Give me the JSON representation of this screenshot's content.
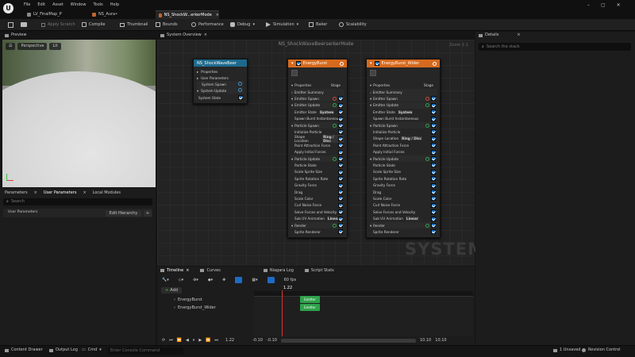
{
  "menu": {
    "items": [
      "File",
      "Edit",
      "Asset",
      "Window",
      "Tools",
      "Help"
    ]
  },
  "tabs": [
    {
      "label": "LV_FinalMap_P"
    },
    {
      "label": "NS_Aura•"
    },
    {
      "label": "NS_ShockW...erkerMode"
    }
  ],
  "toolbar": {
    "apply_scratch": "Apply Scratch",
    "compile": "Compile",
    "thumbnail": "Thumbnail",
    "bounds": "Bounds",
    "performance": "Performance",
    "debug": "Debug",
    "simulation": "Simulation",
    "baker": "Baker",
    "scalability": "Scalability"
  },
  "preview": {
    "tab": "Preview",
    "perspective": "Perspective",
    "lit": "Lit"
  },
  "params": {
    "tab_parameters": "Parameters",
    "tab_user": "User Parameters",
    "tab_local": "Local Modules",
    "search_placeholder": "Search",
    "group": "User Parameters",
    "edit_hierarchy": "Edit Hierarchy"
  },
  "overview": {
    "tab": "System Overview",
    "title": "NS_ShockWaveBeerserkerMode",
    "zoom": "Zoom 1:1",
    "watermark": "SYSTEM"
  },
  "system_node": {
    "title": "NS_ShockWaveBeer",
    "rows": [
      "Properties",
      "User Parameters",
      "System Spawn",
      "System Update",
      "System State"
    ]
  },
  "emitters": [
    {
      "title": "EnergyBurst",
      "rows": [
        "Properties",
        "Emitter Summary",
        "Emitter Spawn",
        "Emitter Update",
        "Emitter State",
        "Spawn Burst Instantaneous",
        "Particle Spawn",
        "Initialize Particle",
        "Shape Location",
        "Point Attraction Force",
        "Apply Initial Forces",
        "Particle Update",
        "Particle State",
        "Scale Sprite Size",
        "Sprite Rotation Rate",
        "Gravity Force",
        "Drag",
        "Scale Color",
        "Curl Noise Force",
        "Solve Forces and Velocity",
        "Sub UV Animation",
        "Render",
        "Sprite Renderer"
      ],
      "stage": "Stage",
      "emitter_state_value": "System",
      "shape_value": "Ring / Disc",
      "subuv_value": "Linear"
    },
    {
      "title": "EnergyBurst_Wider",
      "rows": [
        "Properties",
        "Emitter Summary",
        "Emitter Spawn",
        "Emitter Update",
        "Emitter State",
        "Spawn Burst Instantaneous",
        "Particle Spawn",
        "Initialize Particle",
        "Shape Location",
        "Point Attraction Force",
        "Apply Initial Forces",
        "Particle Update",
        "Particle State",
        "Scale Sprite Size",
        "Sprite Rotation Rate",
        "Gravity Force",
        "Drag",
        "Scale Color",
        "Curl Noise Force",
        "Solve Forces and Velocity",
        "Sub UV Animation",
        "Render",
        "Sprite Renderer"
      ],
      "stage": "Stage",
      "emitter_state_value": "System",
      "shape_value": "Ring / Disc",
      "subuv_value": "Linear"
    }
  ],
  "details": {
    "tab": "Details",
    "search_placeholder": "Search the stack"
  },
  "timeline": {
    "tab_timeline": "Timeline",
    "tab_curves": "Curves",
    "tab_log": "Niagara Log",
    "tab_stats": "Script Stats",
    "fps": "60 fps",
    "add": "Add",
    "playhead": "1.22",
    "tracks": [
      "EnergyBurst",
      "EnergyBurst_Wider"
    ],
    "clip_label": "Emitter",
    "time_value": "1.22",
    "range_start": "-0.10",
    "range_start2": "-0.10",
    "range_end": "10.10",
    "range_end2": "10.10"
  },
  "status": {
    "content_drawer": "Content Drawer",
    "output_log": "Output Log",
    "cmd": "Cmd",
    "console_placeholder": "Enter Console Command",
    "unsaved": "1 Unsaved",
    "revision": "Revision Control"
  }
}
